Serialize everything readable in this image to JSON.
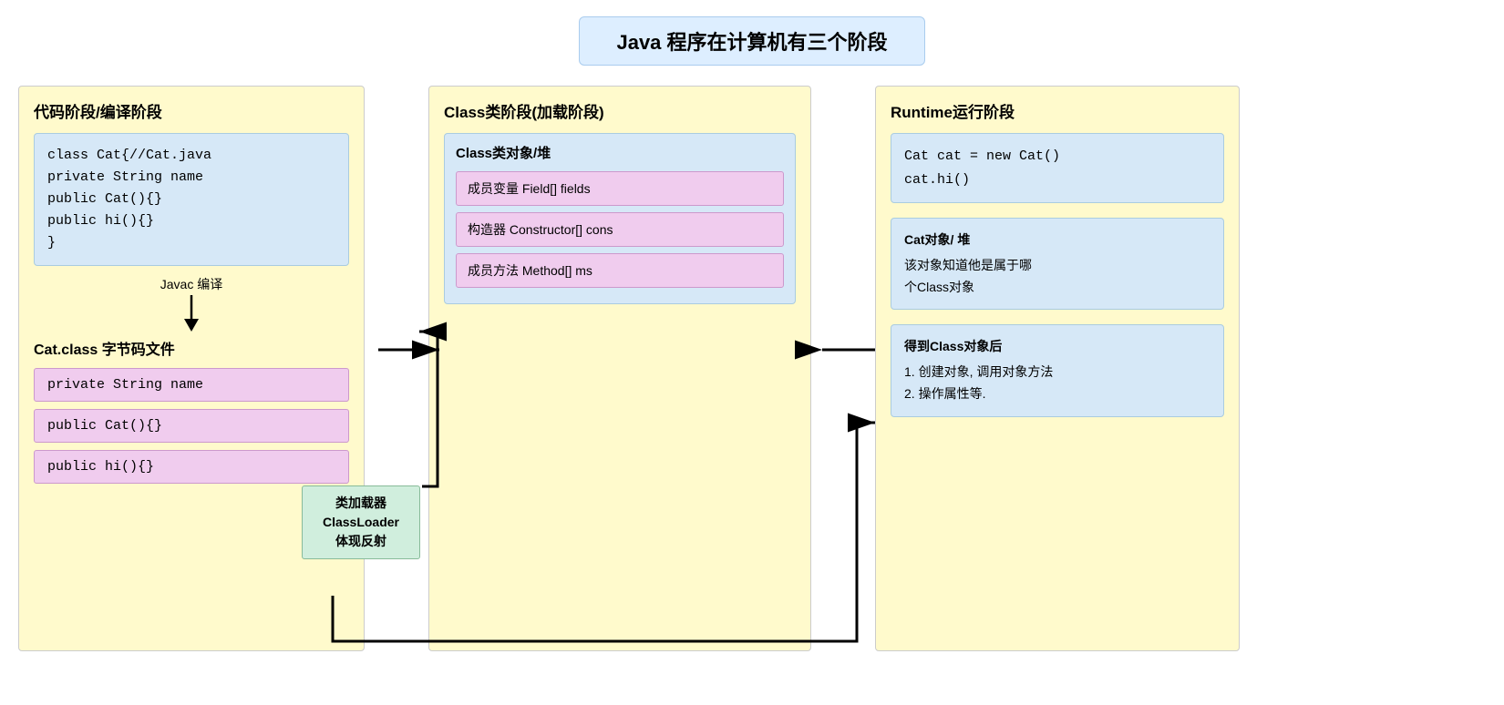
{
  "title": "Java 程序在计算机有三个阶段",
  "phase1": {
    "title": "代码阶段/编译阶段",
    "code_content": "class Cat{//Cat.java\nprivate String name\npublic Cat(){}\npublic hi(){}\n}",
    "arrow_label": "Javac 编译",
    "bytecode_title": "Cat.class 字节码文件",
    "bytecode_items": [
      "private String name",
      "public Cat(){}",
      "public hi(){}"
    ]
  },
  "classloader": {
    "line1": "类加载器",
    "line2": "ClassLoader",
    "line3": "体现反射"
  },
  "phase2": {
    "title": "Class类阶段(加载阶段)",
    "heap_title": "Class类对象/堆",
    "fields": [
      "成员变量 Field[] fields",
      "构造器 Constructor[] cons",
      "成员方法 Method[] ms"
    ]
  },
  "phase3": {
    "title": "Runtime运行阶段",
    "code_content": "Cat cat = new Cat()\ncat.hi()",
    "object_title": "Cat对象/ 堆",
    "object_desc": "该对象知道他是属于哪\n个Class对象",
    "info_title": "得到Class对象后",
    "info_items": [
      "1. 创建对象, 调用对象方法",
      "2. 操作属性等."
    ]
  }
}
